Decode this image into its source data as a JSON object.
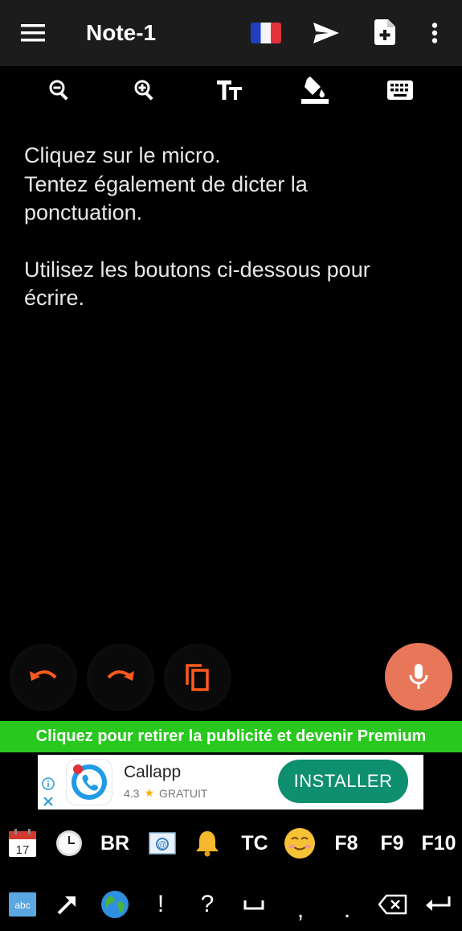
{
  "app_bar": {
    "title": "Note-1",
    "icons": [
      "menu-icon",
      "flag-fr-icon",
      "send-icon",
      "new-document-icon",
      "more-vert-icon"
    ]
  },
  "toolbar": {
    "icons": [
      "zoom-out-icon",
      "zoom-in-icon",
      "text-size-icon",
      "fill-color-icon",
      "keyboard-icon"
    ]
  },
  "note": {
    "lines": [
      "Cliquez sur le micro.",
      "Tentez également de dicter la",
      "ponctuation.",
      "Utilisez les boutons ci-dessous pour",
      "écrire."
    ]
  },
  "actions": {
    "icons": [
      "undo-icon",
      "redo-icon",
      "copy-icon",
      "microphone-icon"
    ],
    "accent_color": "#e8775a",
    "icon_color": "#ff5a1f"
  },
  "premium_banner": {
    "text": "Cliquez pour retirer la publicité et devenir Premium",
    "color": "#28c81e"
  },
  "ad": {
    "app_name": "Callapp",
    "rating": "4.3",
    "price": "GRATUIT",
    "install_label": "INSTALLER",
    "install_color": "#0e8f6f"
  },
  "keyboard": {
    "row1": [
      "calendar-icon",
      "clock-icon",
      "BR",
      "email-icon",
      "bell-icon",
      "TC",
      "smiley-icon",
      "F8",
      "F9",
      "F10"
    ],
    "row2": [
      "abc-icon",
      "arrow-icon",
      "globe-icon",
      "!",
      "?",
      "space-icon",
      ",",
      ".",
      "backspace-icon",
      "enter-icon"
    ]
  }
}
